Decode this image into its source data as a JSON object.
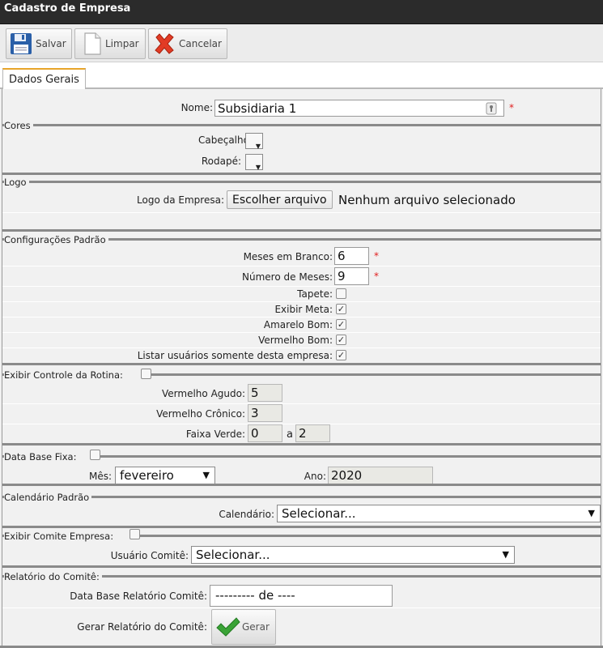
{
  "window": {
    "title": "Cadastro de Empresa"
  },
  "toolbar": {
    "save": "Salvar",
    "clear": "Limpar",
    "cancel": "Cancelar"
  },
  "tabs": [
    {
      "label": "Dados Gerais"
    }
  ],
  "form": {
    "nome": {
      "label": "Nome:",
      "value": "Subsidiaria 1",
      "required": "*"
    },
    "cores": {
      "legend": "Cores",
      "cabecalho": "Cabeçalho:",
      "rodape": "Rodapé:"
    },
    "logo": {
      "legend": "Logo",
      "label": "Logo da Empresa:",
      "button": "Escolher arquivo",
      "status": "Nenhum arquivo selecionado"
    },
    "config": {
      "legend": "Configurações Padrão",
      "meses_branco": {
        "label": "Meses em Branco:",
        "value": "6",
        "required": "*"
      },
      "numero_meses": {
        "label": "Número de Meses:",
        "value": "9",
        "required": "*"
      },
      "tapete": {
        "label": "Tapete:",
        "checked": false
      },
      "exibir_meta": {
        "label": "Exibir Meta:",
        "checked": true
      },
      "amarelo_bom": {
        "label": "Amarelo Bom:",
        "checked": true
      },
      "vermelho_bom": {
        "label": "Vermelho Bom:",
        "checked": true
      },
      "listar_usuarios": {
        "label": "Listar usuários somente desta empresa:",
        "checked": true
      }
    },
    "rotina": {
      "legend": "Exibir Controle da Rotina:",
      "checked": false,
      "vermelho_agudo": {
        "label": "Vermelho Agudo:",
        "value": "5"
      },
      "vermelho_cronico": {
        "label": "Vermelho Crônico:",
        "value": "3"
      },
      "faixa_verde": {
        "label": "Faixa Verde:",
        "from": "0",
        "sep": "a",
        "to": "2"
      }
    },
    "data_base": {
      "legend": "Data Base Fixa:",
      "checked": false,
      "mes": {
        "label": "Mês:",
        "value": "fevereiro"
      },
      "ano": {
        "label": "Ano:",
        "value": "2020"
      }
    },
    "calendario": {
      "legend": "Calendário Padrão",
      "label": "Calendário:",
      "value": "Selecionar..."
    },
    "comite": {
      "legend": "Exibir Comite Empresa:",
      "checked": false,
      "usuario": {
        "label": "Usuário Comitê:",
        "value": "Selecionar..."
      }
    },
    "relatorio": {
      "legend": "Relatório do Comitê:",
      "data_base": {
        "label": "Data Base Relatório Comitê:",
        "value": "--------- de ----"
      },
      "gerar": {
        "label": "Gerar Relatório do Comitê:",
        "button": "Gerar"
      }
    }
  },
  "colors": {
    "titlebar": "#2b2b2b",
    "tab_accent": "#e8a52a",
    "required": "#e02020",
    "cancel_icon": "#e23b25",
    "ok_icon": "#3aa336",
    "save_icon": "#2a5fa8"
  }
}
